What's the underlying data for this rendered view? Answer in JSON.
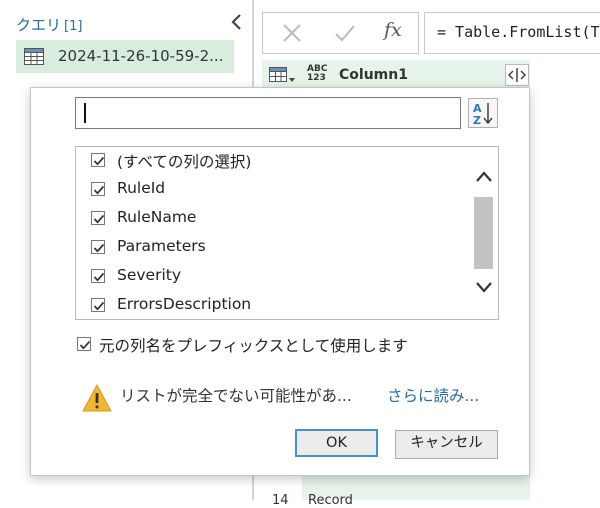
{
  "queries": {
    "header": "クエリ",
    "count": "[1]",
    "items": [
      {
        "name": "2024-11-26-10-59-2...",
        "selected": true
      }
    ]
  },
  "formula": {
    "fx_label": "fx",
    "text": "= Table.FromList(T"
  },
  "grid": {
    "column_header": {
      "type_label_top": "ABC",
      "type_label_bottom": "123",
      "name": "Column1"
    },
    "visible_row": {
      "number": "14",
      "value": "Record"
    }
  },
  "dialog": {
    "search": {
      "value": "",
      "placeholder": ""
    },
    "columns": [
      {
        "label": "(すべての列の選択)",
        "checked": true
      },
      {
        "label": "RuleId",
        "checked": true
      },
      {
        "label": "RuleName",
        "checked": true
      },
      {
        "label": "Parameters",
        "checked": true
      },
      {
        "label": "Severity",
        "checked": true
      },
      {
        "label": "ErrorsDescription",
        "checked": true
      }
    ],
    "prefix_option": {
      "label": "元の列名をプレフィックスとして使用します",
      "checked": true
    },
    "warning_text": "リストが完全でない可能性があ...",
    "load_more_link": "さらに読み...",
    "ok_label": "OK",
    "cancel_label": "キャンセル"
  },
  "colors": {
    "accent": "#2e75b6",
    "link": "#2b6a9b",
    "selection": "#d8eddd",
    "warning": "#f2b632"
  }
}
